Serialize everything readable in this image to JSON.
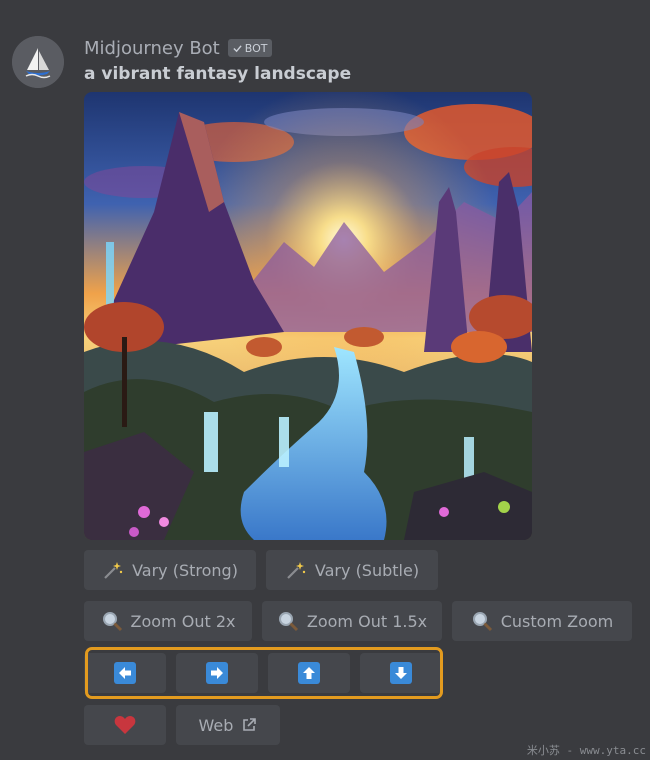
{
  "message": {
    "author": "Midjourney Bot",
    "badge": "BOT",
    "prompt": "a vibrant fantasy landscape"
  },
  "image": {
    "subject": "fantasy-landscape-artwork"
  },
  "buttons": {
    "vary_strong": "Vary (Strong)",
    "vary_subtle": "Vary (Subtle)",
    "zoom_out_2x": "Zoom Out 2x",
    "zoom_out_1_5x": "Zoom Out 1.5x",
    "custom_zoom": "Custom Zoom",
    "pan_left": "pan-left-arrow-icon",
    "pan_right": "pan-right-arrow-icon",
    "pan_up": "pan-up-arrow-icon",
    "pan_down": "pan-down-arrow-icon",
    "web": "Web"
  },
  "watermark": "米小苏 - www.yta.cc",
  "colors": {
    "background": "#3a3b3f",
    "button": "#45474c",
    "arrow_blue": "#3a8ad8",
    "highlight": "#e39b1f",
    "heart": "#c8363e"
  }
}
